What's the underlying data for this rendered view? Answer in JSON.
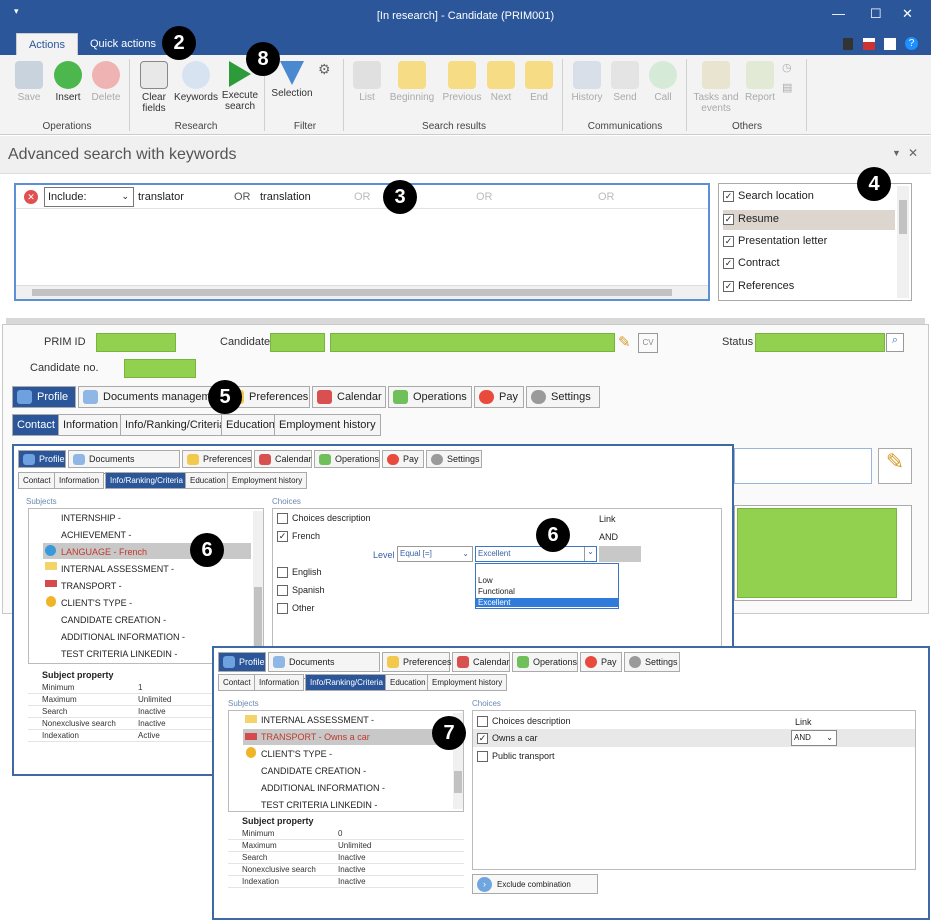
{
  "window": {
    "title": "[In research] - Candidate (PRIM001)",
    "minimize": "—",
    "maximize": "☐",
    "close": "✕"
  },
  "tabs": [
    "Actions",
    "Quick actions"
  ],
  "ribbon": {
    "operations": {
      "label": "Operations",
      "save": "Save",
      "insert": "Insert",
      "delete": "Delete"
    },
    "research": {
      "label": "Research",
      "clear": "Clear\nfields",
      "keywords": "Keywords",
      "execute": "Execute\nsearch"
    },
    "filter": {
      "label": "Filter",
      "selection": "Selection"
    },
    "results": {
      "label": "Search results",
      "list": "List",
      "beginning": "Beginning",
      "previous": "Previous",
      "next": "Next",
      "end": "End"
    },
    "comms": {
      "label": "Communications",
      "history": "History",
      "send": "Send",
      "call": "Call"
    },
    "others": {
      "label": "Others",
      "tasks": "Tasks and\nevents",
      "report": "Report"
    }
  },
  "header": {
    "title": "Advanced search with keywords"
  },
  "criteria": {
    "include": "Include:",
    "kw1": "translator",
    "op1": "OR",
    "kw2": "translation",
    "op2": "OR",
    "op3": "OR",
    "op4": "OR"
  },
  "locations": [
    "Search location",
    "Resume",
    "Presentation letter",
    "Contract",
    "References"
  ],
  "fields": {
    "prim_id": "PRIM ID",
    "candidate": "Candidate",
    "status": "Status",
    "candidate_no": "Candidate no."
  },
  "main_tabs": [
    "Profile",
    "Documents management",
    "Preferences",
    "Calendar",
    "Operations",
    "Pay",
    "Settings"
  ],
  "sub_tabs": [
    "Contact",
    "Information",
    "Info/Ranking/Criteria",
    "Education",
    "Employment history"
  ],
  "p1": {
    "subjects_label": "Subjects",
    "choices_label": "Choices",
    "subjects": [
      "INTERNSHIP -",
      "ACHIEVEMENT -",
      "LANGUAGE - French",
      "INTERNAL ASSESSMENT -",
      "TRANSPORT -",
      "CLIENT'S TYPE -",
      "CANDIDATE CREATION -",
      "ADDITIONAL INFORMATION -",
      "TEST CRITERIA LINKEDIN -"
    ],
    "choices_desc": "Choices description",
    "link": "Link",
    "french": "French",
    "and": "AND",
    "level": "Level",
    "equal": "Equal [=]",
    "excellent": "Excellent",
    "options": [
      "Low",
      "Functional",
      "Excellent"
    ],
    "english": "English",
    "spanish": "Spanish",
    "other": "Other",
    "prop_title": "Subject property",
    "props": [
      [
        "Minimum",
        "1"
      ],
      [
        "Maximum",
        "Unlimited"
      ],
      [
        "Search",
        "Inactive"
      ],
      [
        "Nonexclusive search",
        "Inactive"
      ],
      [
        "Indexation",
        "Active"
      ]
    ]
  },
  "p2": {
    "subjects": [
      "INTERNAL ASSESSMENT -",
      "TRANSPORT - Owns a car",
      "CLIENT'S TYPE -",
      "CANDIDATE CREATION -",
      "ADDITIONAL INFORMATION -",
      "TEST CRITERIA LINKEDIN -"
    ],
    "choices_desc": "Choices description",
    "link": "Link",
    "owns": "Owns a car",
    "and": "AND",
    "public": "Public transport",
    "props": [
      [
        "Minimum",
        "0"
      ],
      [
        "Maximum",
        "Unlimited"
      ],
      [
        "Search",
        "Inactive"
      ],
      [
        "Nonexclusive search",
        "Inactive"
      ],
      [
        "Indexation",
        "Inactive"
      ]
    ],
    "exclude": "Exclude combination"
  },
  "callouts": [
    "2",
    "8",
    "3",
    "4",
    "5",
    "6",
    "6",
    "7"
  ]
}
